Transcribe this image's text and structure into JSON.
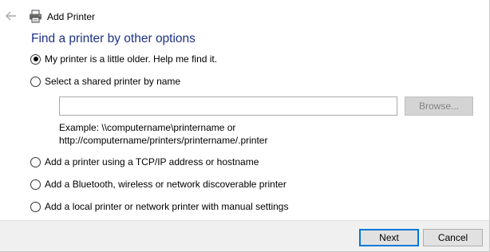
{
  "window": {
    "title": "Add Printer"
  },
  "heading": "Find a printer by other options",
  "options": [
    {
      "label": "My printer is a little older. Help me find it.",
      "checked": true
    },
    {
      "label": "Select a shared printer by name",
      "checked": false
    },
    {
      "label": "Add a printer using a TCP/IP address or hostname",
      "checked": false
    },
    {
      "label": "Add a Bluetooth, wireless or network discoverable printer",
      "checked": false
    },
    {
      "label": "Add a local printer or network printer with manual settings",
      "checked": false
    }
  ],
  "shared_printer": {
    "value": "",
    "browse_label": "Browse...",
    "example_line1": "Example: \\\\computername\\printername or",
    "example_line2": "http://computername/printers/printername/.printer"
  },
  "footer": {
    "next_label": "Next",
    "cancel_label": "Cancel"
  },
  "icons": {
    "back": "back-arrow-icon",
    "printer": "printer-icon"
  }
}
